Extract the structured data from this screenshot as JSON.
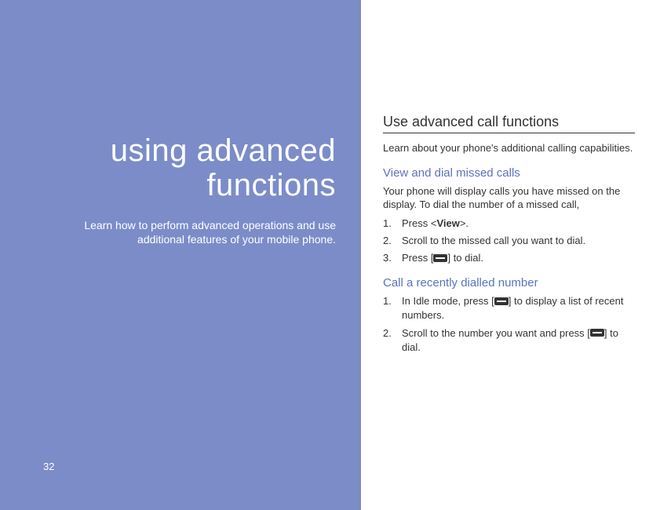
{
  "left": {
    "title_line1": "using advanced",
    "title_line2": "functions",
    "subtitle_line1": "Learn how to perform advanced operations and use",
    "subtitle_line2": "additional features of your mobile phone.",
    "page_number": "32"
  },
  "right": {
    "section_heading": "Use advanced call functions",
    "section_intro": "Learn about your phone's additional calling capabilities.",
    "sub1": {
      "heading": "View and dial missed calls",
      "intro": "Your phone will display calls you have missed on the display. To dial the number of a missed call,",
      "steps": [
        {
          "num": "1.",
          "prefix": "Press <",
          "bold": "View",
          "suffix": ">."
        },
        {
          "num": "2.",
          "text": "Scroll to the missed call you want to dial."
        },
        {
          "num": "3.",
          "prefix": "Press [",
          "icon": true,
          "suffix": "] to dial."
        }
      ]
    },
    "sub2": {
      "heading": "Call a recently dialled number",
      "steps": [
        {
          "num": "1.",
          "prefix": "In Idle mode, press [",
          "icon": true,
          "suffix": "] to display a list of recent numbers."
        },
        {
          "num": "2.",
          "prefix": "Scroll to the number you want and press [",
          "icon": true,
          "suffix": "] to dial."
        }
      ]
    }
  }
}
